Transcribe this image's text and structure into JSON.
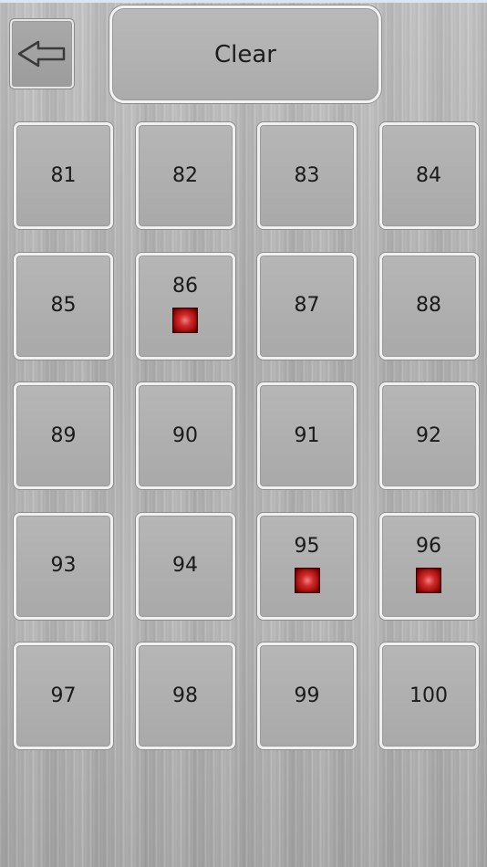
{
  "toolbar": {
    "back_icon": "left-arrow-icon",
    "clear_label": "Clear"
  },
  "colors": {
    "marker": "#c41e1e",
    "background": "#b5b5b5"
  },
  "cells": [
    {
      "label": "81",
      "marked": false
    },
    {
      "label": "82",
      "marked": false
    },
    {
      "label": "83",
      "marked": false
    },
    {
      "label": "84",
      "marked": false
    },
    {
      "label": "85",
      "marked": false
    },
    {
      "label": "86",
      "marked": true
    },
    {
      "label": "87",
      "marked": false
    },
    {
      "label": "88",
      "marked": false
    },
    {
      "label": "89",
      "marked": false
    },
    {
      "label": "90",
      "marked": false
    },
    {
      "label": "91",
      "marked": false
    },
    {
      "label": "92",
      "marked": false
    },
    {
      "label": "93",
      "marked": false
    },
    {
      "label": "94",
      "marked": false
    },
    {
      "label": "95",
      "marked": true
    },
    {
      "label": "96",
      "marked": true
    },
    {
      "label": "97",
      "marked": false
    },
    {
      "label": "98",
      "marked": false
    },
    {
      "label": "99",
      "marked": false
    },
    {
      "label": "100",
      "marked": false
    }
  ]
}
